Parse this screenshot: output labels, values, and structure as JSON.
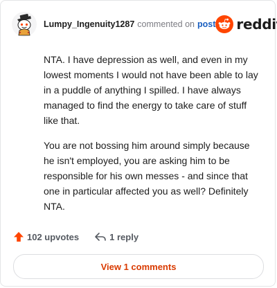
{
  "header": {
    "username": "Lumpy_Ingenuity1287",
    "commented_text": "commented on",
    "post_link": "post",
    "brand": "reddit"
  },
  "comment": {
    "paragraphs": [
      "NTA. I have depression as well, and even in my lowest moments I would not have been able to lay in a puddle of anything I spilled. I have always managed to find the energy to take care of stuff like that.",
      "You are not bossing him around simply because he isn't employed, you are asking him to be responsible for his own messes - and since that one in particular affected you as well? Definitely NTA."
    ]
  },
  "actions": {
    "upvotes": "102 upvotes",
    "replies": "1 reply"
  },
  "view_button": "View 1 comments",
  "colors": {
    "brand_orange": "#ff4500",
    "link_blue": "#1a5fc0",
    "button_text": "#d93a00",
    "text": "#1c1c1c"
  },
  "icons": [
    "avatar-icon",
    "reddit-snoo-icon",
    "upvote-arrow-icon",
    "reply-arrow-icon"
  ]
}
